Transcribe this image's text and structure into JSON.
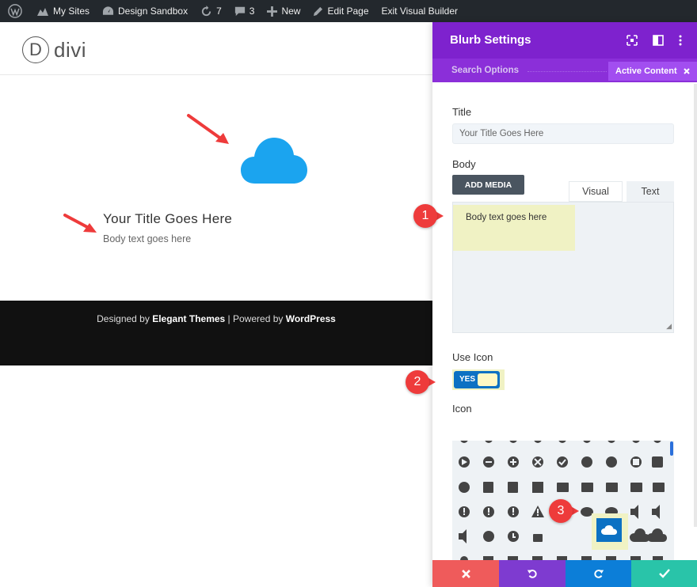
{
  "adminbar": {
    "my_sites": "My Sites",
    "site_name": "Design Sandbox",
    "updates_count": "7",
    "comments_count": "3",
    "new_label": "New",
    "edit_page": "Edit Page",
    "exit_builder": "Exit Visual Builder"
  },
  "site": {
    "logo_letter": "D",
    "logo_text": "divi",
    "blurb_title": "Your Title Goes Here",
    "blurb_body": "Body text goes here",
    "footer_prefix": "Designed by ",
    "footer_brand": "Elegant Themes",
    "footer_mid": " | Powered by ",
    "footer_wp": "WordPress"
  },
  "panel": {
    "title": "Blurb Settings",
    "search_options": "Search Options",
    "active_content": "Active Content",
    "title_label": "Title",
    "title_value": "Your Title Goes Here",
    "body_label": "Body",
    "add_media": "ADD MEDIA",
    "tab_visual": "Visual",
    "tab_text": "Text",
    "body_value": "Body text goes here",
    "use_icon_label": "Use Icon",
    "use_icon_value": "YES",
    "icon_label": "Icon"
  },
  "markers": {
    "one": "1",
    "two": "2",
    "three": "3"
  },
  "colors": {
    "header_purple": "#7e22ce",
    "accent_blue": "#0c71c3",
    "cloud_blue": "#1ba4ef",
    "cancel_red": "#ef5b5b",
    "undo_purple": "#7e3bd0",
    "redo_blue": "#0c7ed8",
    "save_green": "#29c4a9",
    "highlight_yellow": "#f0f2c4"
  }
}
